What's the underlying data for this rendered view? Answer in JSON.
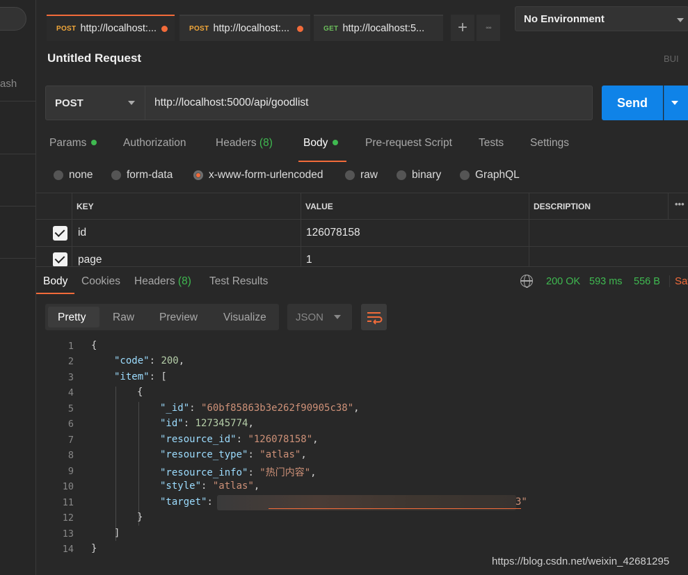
{
  "sidebar": {
    "fragment": "ash"
  },
  "tabs": [
    {
      "method": "POST",
      "url": "http://localhost:...",
      "unsaved": true
    },
    {
      "method": "POST",
      "url": "http://localhost:...",
      "unsaved": true
    },
    {
      "method": "GET",
      "url": "http://localhost:5..."
    }
  ],
  "tab_actions": {
    "add_icon": "+",
    "more_icon": "◦◦◦"
  },
  "environment": {
    "selected": "No Environment"
  },
  "request": {
    "title": "Untitled Request",
    "build_fragment": "BUI",
    "method": "POST",
    "url": "http://localhost:5000/api/goodlist",
    "send_label": "Send"
  },
  "request_tabs": {
    "params": "Params",
    "authorization": "Authorization",
    "headers": "Headers",
    "headers_count": "(8)",
    "body": "Body",
    "prerequest": "Pre-request Script",
    "tests": "Tests",
    "settings": "Settings"
  },
  "body_types": [
    "none",
    "form-data",
    "x-www-form-urlencoded",
    "raw",
    "binary",
    "GraphQL"
  ],
  "body_type_selected": "x-www-form-urlencoded",
  "kv_table": {
    "headers": [
      "KEY",
      "VALUE",
      "DESCRIPTION"
    ],
    "more_icon": "•••",
    "rows": [
      {
        "key": "id",
        "value": "126078158",
        "checked": true
      },
      {
        "key": "page",
        "value": "1",
        "checked": true
      }
    ]
  },
  "response": {
    "tabs": {
      "body": "Body",
      "cookies": "Cookies",
      "headers": "Headers",
      "headers_count": "(8)",
      "test_results": "Test Results"
    },
    "status": "200 OK",
    "time": "593 ms",
    "size": "556 B",
    "save_fragment": "Sav",
    "views": [
      "Pretty",
      "Raw",
      "Preview",
      "Visualize"
    ],
    "format": "JSON"
  },
  "code_lines": {
    "l1": "{",
    "l2_key": "\"code\"",
    "l2_val": "200",
    "l3_key": "\"item\"",
    "l3_rest": ": [",
    "l4": "{",
    "l5_key": "\"_id\"",
    "l5_val": "\"60bf85863b3e262f90905c38\"",
    "l6_key": "\"id\"",
    "l6_val": "127345774",
    "l7_key": "\"resource_id\"",
    "l7_val": "\"126078158\"",
    "l8_key": "\"resource_type\"",
    "l8_val": "\"atlas\"",
    "l9_key": "\"resource_info\"",
    "l9_val": "\"热门内容\"",
    "l10_key": "\"style\"",
    "l10_val": "\"atlas\"",
    "l11_key": "\"target\"",
    "l11_tail": "3\"",
    "l12": "}",
    "l13": "]",
    "l14": "}"
  },
  "watermark": "https://blog.csdn.net/weixin_42681295",
  "colors": {
    "accent": "#f26b3a",
    "send": "#0f83e8",
    "success": "#3fb950"
  }
}
